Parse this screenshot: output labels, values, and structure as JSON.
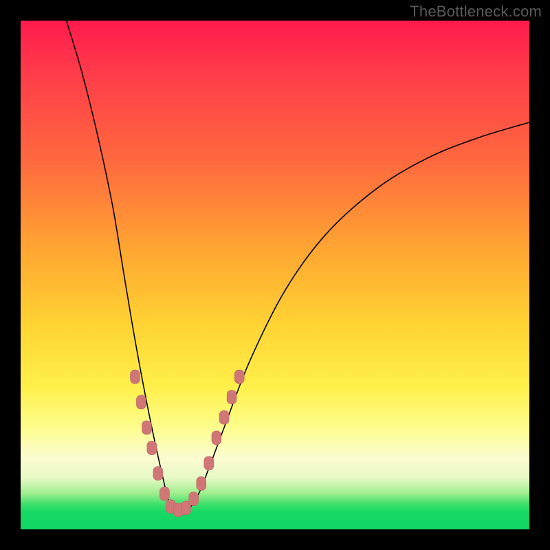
{
  "watermark": "TheBottleneck.com",
  "colors": {
    "frame": "#000000",
    "gradient_stops": [
      "#ff1a4d",
      "#ff6a3e",
      "#ffd433",
      "#fcfcd2",
      "#17d964"
    ],
    "curve": "#000000",
    "marker_fill": "#d07676",
    "marker_stroke": "#b55f5f"
  },
  "chart_data": {
    "type": "line",
    "title": "",
    "subtitle": "",
    "xlabel": "",
    "ylabel": "",
    "x_range": [
      0,
      100
    ],
    "y_range": [
      0,
      100
    ],
    "note": "No axes, ticks, or numeric labels are rendered in the image; values are read as percentages of the plot area (0,0 = bottom-left, 100,100 = top-right).",
    "series": [
      {
        "name": "bottleneck-curve",
        "description": "V-shaped curve: steep left descent into a narrow valley near x≈30, then a gentler rise to the right edge.",
        "points": [
          {
            "x": 9,
            "y": 100
          },
          {
            "x": 12,
            "y": 90
          },
          {
            "x": 15,
            "y": 78
          },
          {
            "x": 18,
            "y": 64
          },
          {
            "x": 20,
            "y": 52
          },
          {
            "x": 22,
            "y": 40
          },
          {
            "x": 24,
            "y": 29
          },
          {
            "x": 26,
            "y": 19
          },
          {
            "x": 28,
            "y": 10
          },
          {
            "x": 29,
            "y": 6
          },
          {
            "x": 30,
            "y": 4
          },
          {
            "x": 31,
            "y": 3.5
          },
          {
            "x": 33,
            "y": 4
          },
          {
            "x": 35,
            "y": 7
          },
          {
            "x": 37,
            "y": 12
          },
          {
            "x": 40,
            "y": 20
          },
          {
            "x": 45,
            "y": 33
          },
          {
            "x": 52,
            "y": 47
          },
          {
            "x": 60,
            "y": 58
          },
          {
            "x": 70,
            "y": 67
          },
          {
            "x": 80,
            "y": 73
          },
          {
            "x": 90,
            "y": 77
          },
          {
            "x": 100,
            "y": 80
          }
        ]
      }
    ],
    "markers": {
      "name": "data-cluster",
      "description": "Salmon round-rect markers clustered along the curve near the valley, below roughly y=30%.",
      "points": [
        {
          "x": 22.5,
          "y": 30
        },
        {
          "x": 23.7,
          "y": 25
        },
        {
          "x": 24.8,
          "y": 20
        },
        {
          "x": 25.8,
          "y": 16
        },
        {
          "x": 27.0,
          "y": 11
        },
        {
          "x": 28.3,
          "y": 7
        },
        {
          "x": 29.5,
          "y": 4.5
        },
        {
          "x": 31.0,
          "y": 3.8
        },
        {
          "x": 32.5,
          "y": 4.2
        },
        {
          "x": 34.0,
          "y": 6
        },
        {
          "x": 35.5,
          "y": 9
        },
        {
          "x": 37.0,
          "y": 13
        },
        {
          "x": 38.5,
          "y": 18
        },
        {
          "x": 40.0,
          "y": 22
        },
        {
          "x": 41.5,
          "y": 26
        },
        {
          "x": 43.0,
          "y": 30
        }
      ]
    }
  }
}
